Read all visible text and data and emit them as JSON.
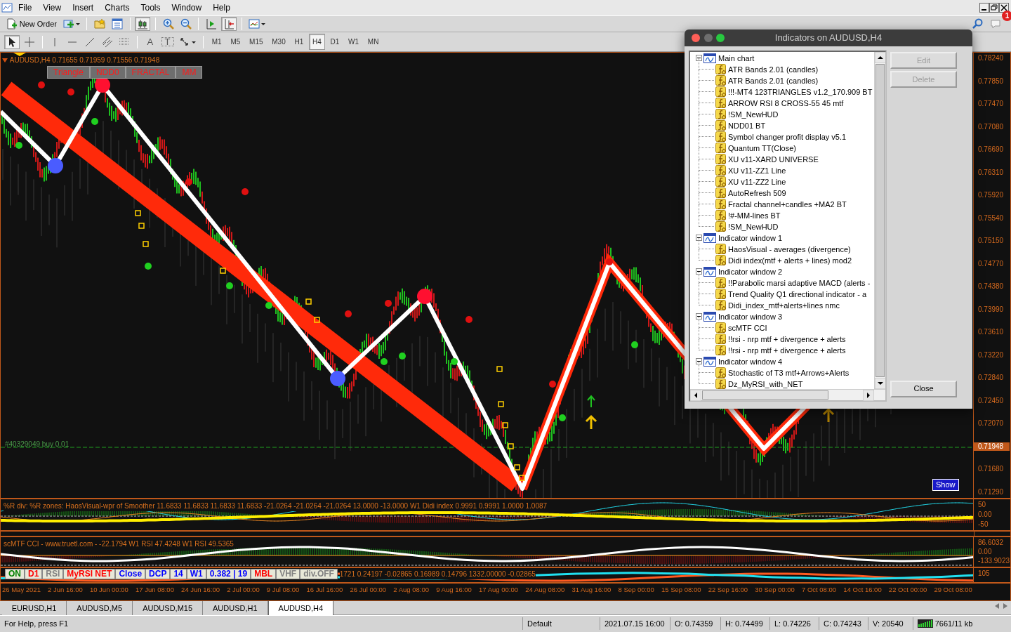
{
  "menu": [
    "File",
    "View",
    "Insert",
    "Charts",
    "Tools",
    "Window",
    "Help"
  ],
  "toolbar": {
    "new_order": "New Order",
    "buttons": [
      {
        "kind": "add",
        "pressed": false
      },
      {
        "kind": "folder-star",
        "pressed": false
      },
      {
        "kind": "window-list",
        "pressed": false
      },
      {
        "kind": "bars",
        "pressed": true
      },
      {
        "kind": "zoom-in",
        "pressed": false
      },
      {
        "kind": "zoom-out",
        "pressed": false
      },
      {
        "kind": "shift",
        "pressed": false
      },
      {
        "kind": "autoscroll",
        "pressed": true
      },
      {
        "kind": "templates",
        "pressed": false
      }
    ],
    "tools": [
      {
        "kind": "cursor",
        "pressed": true
      },
      {
        "kind": "crosshair",
        "pressed": false
      },
      {
        "kind": "vline",
        "pressed": false
      },
      {
        "kind": "hline",
        "pressed": false
      },
      {
        "kind": "tline",
        "pressed": false
      },
      {
        "kind": "channel",
        "pressed": false
      },
      {
        "kind": "fibo",
        "pressed": false
      },
      {
        "kind": "text",
        "label": "A",
        "pressed": false
      },
      {
        "kind": "label",
        "label": "T",
        "pressed": false
      },
      {
        "kind": "arrows",
        "pressed": false
      }
    ],
    "timeframes": [
      {
        "label": "M1",
        "selected": false
      },
      {
        "label": "M5",
        "selected": false
      },
      {
        "label": "M15",
        "selected": false
      },
      {
        "label": "M30",
        "selected": false
      },
      {
        "label": "H1",
        "selected": false
      },
      {
        "label": "H4",
        "selected": true
      },
      {
        "label": "D1",
        "selected": false
      },
      {
        "label": "W1",
        "selected": false
      },
      {
        "label": "MN",
        "selected": false
      }
    ]
  },
  "notifications": {
    "badge": "1"
  },
  "chart": {
    "header": "AUDUSD,H4  0.71655 0.71959 0.71556 0.71948",
    "buttons": [
      "Triangle",
      "NDD0",
      "FRACTAL",
      "MM"
    ],
    "order_line": "#40329049 buy 0.01",
    "show_button": "Show",
    "price_axis": [
      {
        "label": "0.78240",
        "current": false
      },
      {
        "label": "0.77850",
        "current": false
      },
      {
        "label": "0.77470",
        "current": false
      },
      {
        "label": "0.77080",
        "current": false
      },
      {
        "label": "0.76690",
        "current": false
      },
      {
        "label": "0.76310",
        "current": false
      },
      {
        "label": "0.75920",
        "current": false
      },
      {
        "label": "0.75540",
        "current": false
      },
      {
        "label": "0.75150",
        "current": false
      },
      {
        "label": "0.74770",
        "current": false
      },
      {
        "label": "0.74380",
        "current": false
      },
      {
        "label": "0.73990",
        "current": false
      },
      {
        "label": "0.73610",
        "current": false
      },
      {
        "label": "0.73220",
        "current": false
      },
      {
        "label": "0.72840",
        "current": false
      },
      {
        "label": "0.72450",
        "current": false
      },
      {
        "label": "0.72070",
        "current": false
      },
      {
        "label": "0.71948",
        "current": true
      },
      {
        "label": "0.71680",
        "current": false
      },
      {
        "label": "0.71290",
        "current": false
      }
    ],
    "time_axis": [
      "26 May 2021",
      "2 Jun 16:00",
      "10 Jun 00:00",
      "17 Jun 08:00",
      "24 Jun 16:00",
      "2 Jul 00:00",
      "9 Jul 08:00",
      "16 Jul 16:00",
      "26 Jul 00:00",
      "2 Aug 08:00",
      "9 Aug 16:00",
      "17 Aug 00:00",
      "24 Aug 08:00",
      "31 Aug 16:00",
      "8 Sep 00:00",
      "15 Sep 08:00",
      "22 Sep 16:00",
      "30 Sep 00:00",
      "7 Oct 08:00",
      "14 Oct 16:00",
      "22 Oct 00:00",
      "29 Oct 08:00"
    ]
  },
  "subwindows": [
    {
      "header": "%R div: %R zones:  HaosVisual-wpr of Smoother 11.6833 11.6833 11.6833 11.6833 -21.0264 -21.0264 -21.0264 13.0000 -13.0000  W1 Didi index 0.9991 0.9991 1.0000 1.0087",
      "axis": [
        "50",
        "0.00",
        "-50"
      ]
    },
    {
      "header": "scMTF CCI - www.truetl.com - -22.1794  W1 RSI 47.4248  W1 RSI 49.5365",
      "axis": [
        "86.6032",
        "0.00",
        "-133.9023"
      ]
    },
    {
      "buttons": [
        {
          "label": "ON",
          "color": "#008000"
        },
        {
          "label": "D1",
          "color": "#ff0000"
        },
        {
          "label": "RSI",
          "color": "#808080"
        },
        {
          "label": "MyRSI NET",
          "color": "#ff0000"
        },
        {
          "label": "Close",
          "color": "#0000ff"
        },
        {
          "label": "DCP",
          "color": "#0000ff"
        },
        {
          "label": "14",
          "color": "#0000ff"
        },
        {
          "label": "W1",
          "color": "#0000ff"
        },
        {
          "label": "0.382 | 19",
          "color": "#0000ff"
        },
        {
          "label": "MBL",
          "color": "#ff0000"
        },
        {
          "label": "VHF",
          "color": "#808080"
        },
        {
          "label": "div.OFF",
          "color": "#808080"
        }
      ],
      "readout": "1721 0.24197 -0.02865 0.16989 0.14796 1332.00000 -0.02865",
      "axis": [
        "105"
      ]
    }
  ],
  "tabs": [
    {
      "label": "EURUSD,H1",
      "selected": false
    },
    {
      "label": "AUDUSD,M5",
      "selected": false
    },
    {
      "label": "AUDUSD,M15",
      "selected": false
    },
    {
      "label": "AUDUSD,H1",
      "selected": false
    },
    {
      "label": "AUDUSD,H4",
      "selected": true
    }
  ],
  "status_bar": {
    "help": "For Help, press F1",
    "profile": "Default",
    "time": "2021.07.15 16:00",
    "open": "O: 0.74359",
    "high": "H: 0.74499",
    "low": "L: 0.74226",
    "close": "C: 0.74243",
    "volume": "V: 20540",
    "traffic": "7661/11 kb"
  },
  "dialog": {
    "title": "Indicators on AUDUSD,H4",
    "tree": [
      {
        "label": "Main chart",
        "expanded": true,
        "children": [
          {
            "label": "ATR Bands 2.01 (candles)"
          },
          {
            "label": "ATR Bands 2.01 (candles)"
          },
          {
            "label": "!!!-MT4 123TRIANGLES v1.2_170.909 BT"
          },
          {
            "label": "ARROW RSI 8 CROSS-55 45 mtf"
          },
          {
            "label": "!SM_NewHUD"
          },
          {
            "label": "NDD01 BT"
          },
          {
            "label": "Symbol changer profit display v5.1"
          },
          {
            "label": "Quantum TT(Close)"
          },
          {
            "label": "XU v11-XARD UNIVERSE"
          },
          {
            "label": "XU v11-ZZ1 Line"
          },
          {
            "label": "XU v11-ZZ2 Line"
          },
          {
            "label": "AutoRefresh 509"
          },
          {
            "label": "Fractal channel+candles +MA2  BT"
          },
          {
            "label": "!#-MM-lines BT"
          },
          {
            "label": "!SM_NewHUD"
          }
        ]
      },
      {
        "label": "Indicator window 1",
        "expanded": true,
        "children": [
          {
            "label": "HaosVisual - averages (divergence)"
          },
          {
            "label": "Didi index(mtf + alerts + lines) mod2"
          }
        ]
      },
      {
        "label": "Indicator window 2",
        "expanded": true,
        "children": [
          {
            "label": "!!Parabolic marsi adaptive MACD (alerts -"
          },
          {
            "label": "Trend Quality Q1 directional indicator - a"
          },
          {
            "label": "Didi_index_mtf+alerts+lines nmc"
          }
        ]
      },
      {
        "label": "Indicator window 3",
        "expanded": true,
        "children": [
          {
            "label": "scMTF CCI"
          },
          {
            "label": "!!rsi - nrp mtf + divergence + alerts"
          },
          {
            "label": "!!rsi - nrp mtf + divergence + alerts"
          }
        ]
      },
      {
        "label": "Indicator window 4",
        "expanded": true,
        "children": [
          {
            "label": "Stochastic of T3 mtf+Arrows+Alerts"
          },
          {
            "label": "Dz_MyRSI_with_NET"
          }
        ]
      }
    ],
    "buttons": [
      {
        "label": "Edit",
        "disabled": true
      },
      {
        "label": "Delete",
        "disabled": true
      },
      {
        "label": "Close",
        "disabled": false
      }
    ]
  }
}
